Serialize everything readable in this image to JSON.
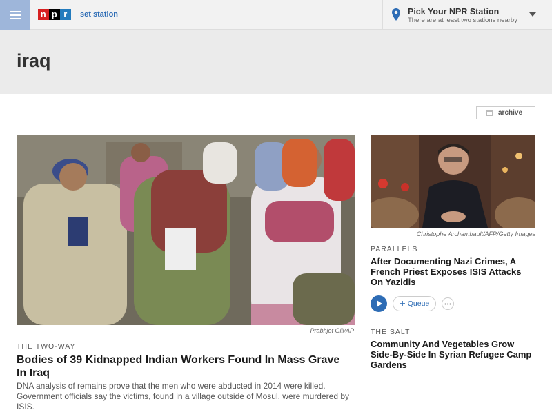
{
  "header": {
    "brand_letters": [
      "n",
      "p",
      "r"
    ],
    "set_station_label": "set station",
    "station_title": "Pick Your NPR Station",
    "station_subtitle": "There are at least two stations nearby"
  },
  "page": {
    "title": "iraq",
    "archive_label": "archive"
  },
  "main_story": {
    "image_credit": "Prabhjot Gill/AP",
    "slug": "THE TWO-WAY",
    "headline": "Bodies of 39 Kidnapped Indian Workers Found In Mass Grave In Iraq",
    "teaser": "DNA analysis of remains prove that the men who were abducted in 2014 were killed. Government officials say the victims, found in a village outside of Mosul, were murdered by ISIS."
  },
  "side_stories": [
    {
      "image_credit": "Christophe Archambault/AFP/Getty Images",
      "slug": "PARALLELS",
      "headline": "After Documenting Nazi Crimes, A French Priest Exposes ISIS Attacks On Yazidis",
      "queue_label": "Queue"
    },
    {
      "slug": "THE SALT",
      "headline": "Community And Vegetables Grow Side-By-Side In Syrian Refugee Camp Gardens"
    }
  ],
  "colors": {
    "npr_red": "#d62021",
    "npr_black": "#000000",
    "npr_blue": "#237bbd",
    "link_blue": "#2d6cb5",
    "menu_bg": "#9eb6da"
  },
  "icons": [
    "menu-icon",
    "location-pin-icon",
    "caret-down-icon",
    "calendar-icon",
    "play-icon",
    "plus-icon",
    "more-icon"
  ]
}
